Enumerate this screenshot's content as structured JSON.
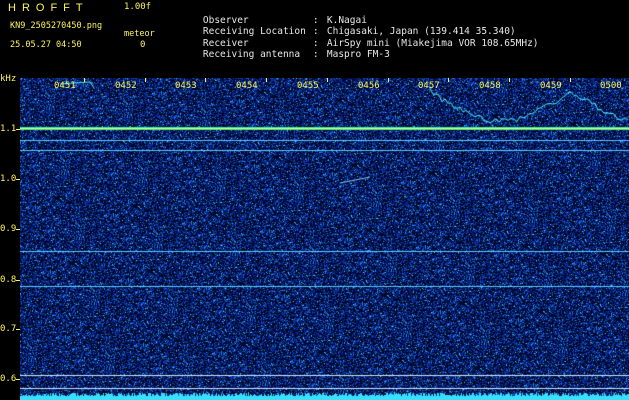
{
  "header": {
    "app_title": "HROFFT",
    "version": "1.00f",
    "filename": "KN9_2505270450.png",
    "meteor_label": "meteor",
    "meteor_count": "0",
    "datetime": "25.05.27 04:50"
  },
  "info": [
    {
      "key": "Observer",
      "value": "K.Nagai"
    },
    {
      "key": "Receiving Location",
      "value": "Chigasaki, Japan (139.414 35.340)"
    },
    {
      "key": "Receiver",
      "value": "AirSpy mini (Miakejima VOR 108.65MHz)"
    },
    {
      "key": "Receiving antenna",
      "value": "Maspro FM-3"
    }
  ],
  "axis": {
    "unit": "kHz",
    "y_ticks": [
      "1.1",
      "1.0",
      "0.9",
      "0.8",
      "0.7",
      "0.6"
    ],
    "x_ticks": [
      "0451",
      "0452",
      "0453",
      "0454",
      "0455",
      "0456",
      "0457",
      "0458",
      "0459",
      "0500"
    ]
  },
  "colors": {
    "label": "#fff45a",
    "background": "#00082c",
    "noise": "#2a5bd6",
    "signal": "#4ff0ff"
  },
  "spectrogram": {
    "freq_range_khz": [
      0.57,
      1.22
    ],
    "time_range": [
      "0450",
      "0500"
    ],
    "carriers_khz": [
      1.12,
      1.095,
      1.075,
      0.87,
      0.8,
      0.62,
      0.595
    ]
  }
}
